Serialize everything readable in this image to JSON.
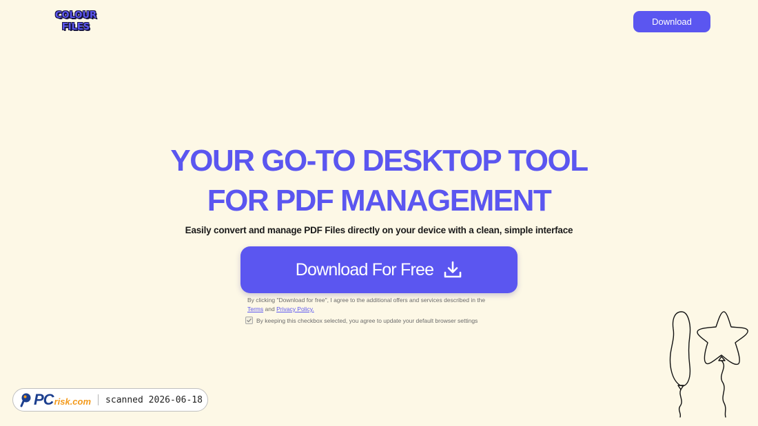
{
  "header": {
    "logo": {
      "line1": "COLOUR",
      "line2": "FILES"
    },
    "download_label": "Download"
  },
  "hero": {
    "headline_line1": "YOUR GO-TO DESKTOP TOOL",
    "headline_line2": "FOR PDF MANAGEMENT",
    "subheadline": "Easily convert and manage PDF Files directly on your device with a clean, simple interface",
    "cta_label": "Download For Free",
    "cta_icon": "download-icon"
  },
  "legal": {
    "text_before": "By clicking \"Download for free\", I agree to the additional offers and services described in the",
    "terms_link": "Terms",
    "and": "and",
    "privacy_link": "Privacy Policy.",
    "checkbox_label": "By keeping this checkbox selected, you agree to update your default browser settings",
    "checkbox_checked": true
  },
  "badge": {
    "brand_pc": "PC",
    "brand_risk": "risk.com",
    "scan_text": "scanned 2026-06-18"
  },
  "colors": {
    "background": "#fdf8e6",
    "accent": "#5b56f0",
    "text": "#1a1a1a",
    "muted": "#6b6b6b"
  },
  "decor": [
    "balloon-icon",
    "star-balloon-icon"
  ]
}
